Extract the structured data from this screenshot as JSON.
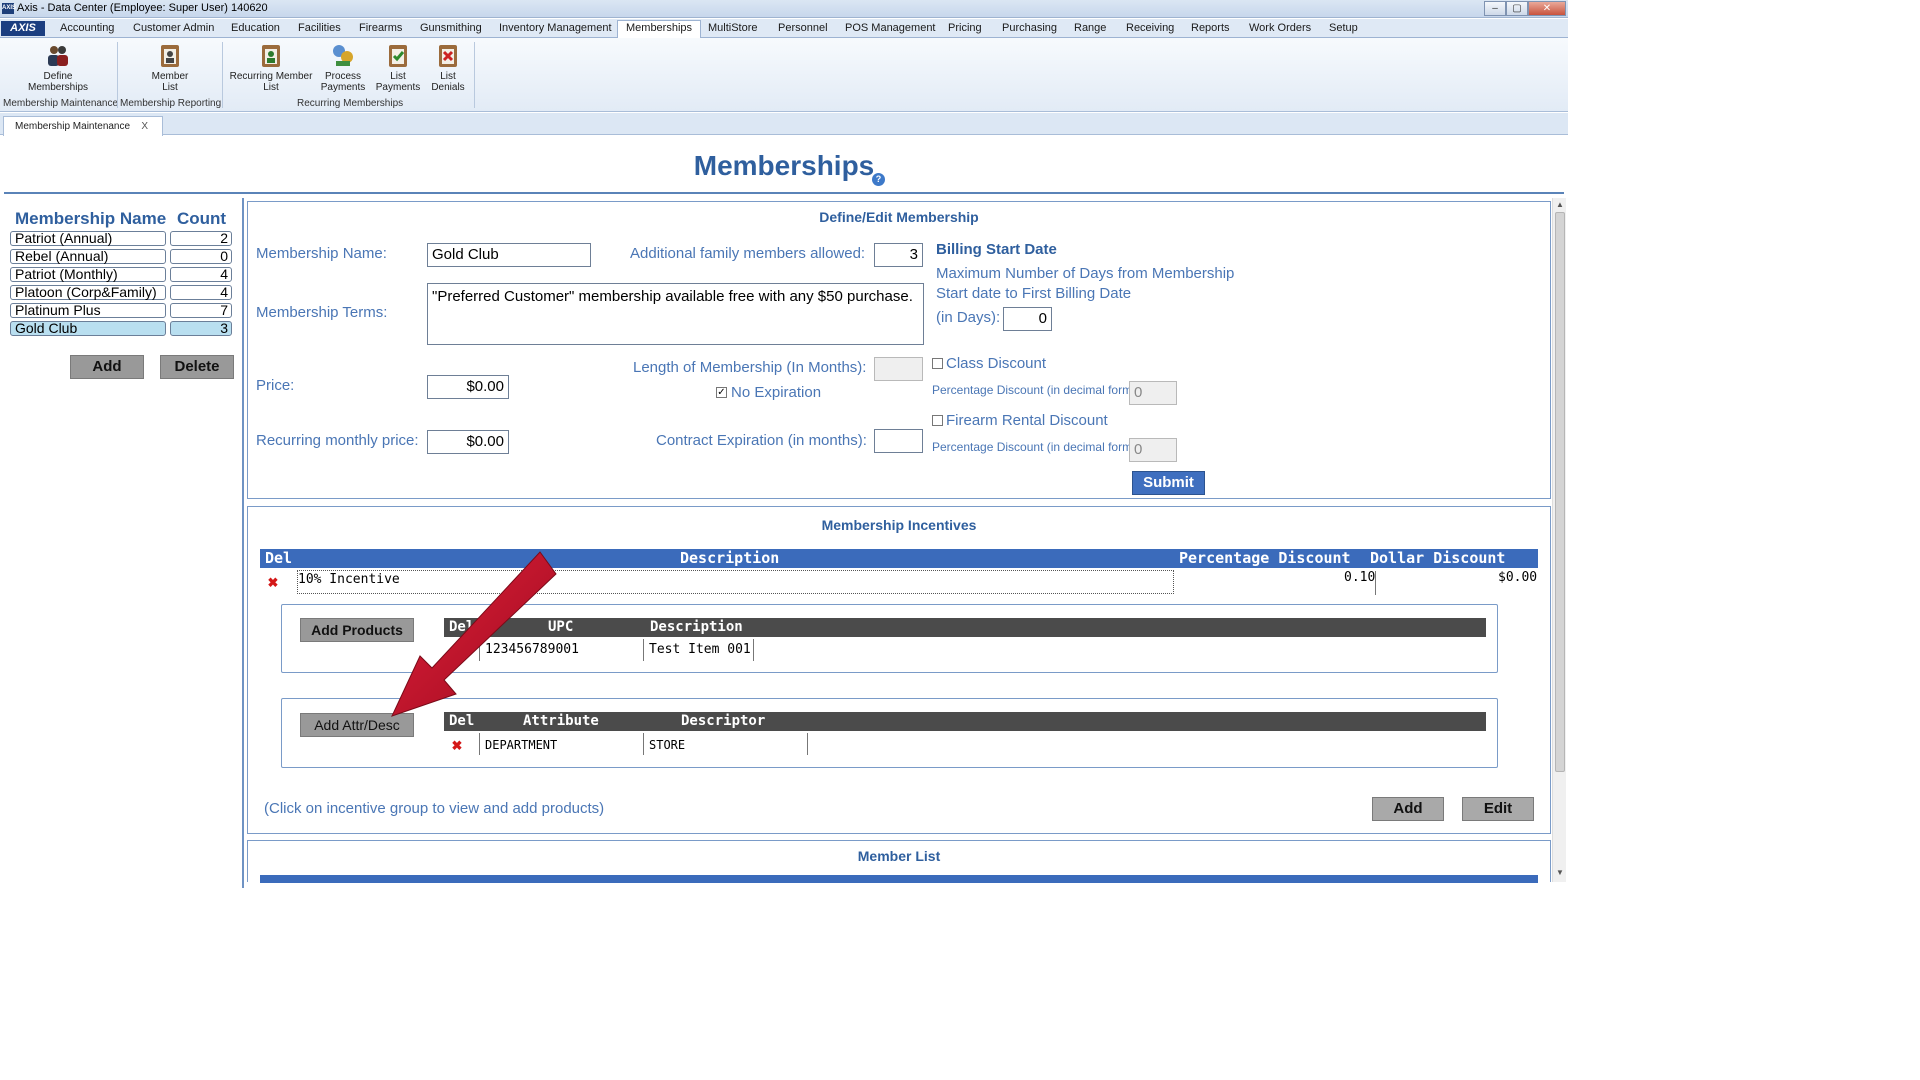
{
  "window": {
    "app_icon": "AXIS",
    "title": "Axis - Data Center  (Employee: Super User) 140620",
    "min": "–",
    "max": "▢",
    "close": "✕"
  },
  "menu": {
    "logo": "AXIS",
    "tabs": [
      "Accounting",
      "Customer Admin",
      "Education",
      "Facilities",
      "Firearms",
      "Gunsmithing",
      "Inventory Management",
      "Memberships",
      "MultiStore",
      "Personnel",
      "POS Management",
      "Pricing",
      "Purchasing",
      "Range",
      "Receiving",
      "Reports",
      "Work Orders",
      "Setup"
    ],
    "active": "Memberships"
  },
  "ribbon": {
    "buttons": [
      {
        "label1": "Define",
        "label2": "Memberships",
        "icon": "people-icon"
      },
      {
        "label1": "Member",
        "label2": "List",
        "icon": "clipboard-icon"
      },
      {
        "label1": "Recurring Member",
        "label2": "List",
        "icon": "recurring-list-icon"
      },
      {
        "label1": "Process",
        "label2": "Payments",
        "icon": "process-payments-icon"
      },
      {
        "label1": "List",
        "label2": "Payments",
        "icon": "list-payments-icon"
      },
      {
        "label1": "List",
        "label2": "Denials",
        "icon": "list-denials-icon"
      }
    ],
    "groups": [
      "Membership Maintenance",
      "Membership Reporting",
      "Recurring Memberships"
    ]
  },
  "doc_tab": {
    "label": "Membership Maintenance",
    "close": "X"
  },
  "page": {
    "title": "Memberships",
    "help": "?"
  },
  "memberships": {
    "header_name": "Membership Name",
    "header_count": "Count",
    "rows": [
      {
        "name": "Patriot (Annual)",
        "count": "2"
      },
      {
        "name": "Rebel (Annual)",
        "count": "0"
      },
      {
        "name": "Patriot (Monthly)",
        "count": "4"
      },
      {
        "name": "Platoon (Corp&Family)",
        "count": "4"
      },
      {
        "name": "Platinum Plus",
        "count": "7"
      },
      {
        "name": "Gold Club",
        "count": "3"
      }
    ],
    "selected_index": 5,
    "add_label": "Add",
    "delete_label": "Delete"
  },
  "define_edit": {
    "title": "Define/Edit Membership",
    "name_label": "Membership Name:",
    "name_value": "Gold Club",
    "family_label": "Additional family members allowed:",
    "family_value": "3",
    "terms_label": "Membership Terms:",
    "terms_value": "\"Preferred Customer\" membership available free with any $50 purchase.",
    "price_label": "Price:",
    "price_value": "$0.00",
    "length_label": "Length of Membership (In Months):",
    "length_value": "",
    "no_expiration_label": "No Expiration",
    "no_expiration_checked": true,
    "recurring_label": "Recurring monthly price:",
    "recurring_value": "$0.00",
    "contract_label": "Contract Expiration (in months):",
    "contract_value": "",
    "billing_title": "Billing Start Date",
    "billing_line1": "Maximum Number of Days from Membership",
    "billing_line2": "Start date to First Billing Date",
    "billing_days_label": "(in Days):",
    "billing_days_value": "0",
    "class_discount_label": "Class Discount",
    "class_pct_label": "Percentage Discount (in decimal form)",
    "class_pct_value": "0",
    "firearm_discount_label": "Firearm Rental Discount",
    "firearm_pct_label": "Percentage Discount (in decimal form)",
    "firearm_pct_value": "0",
    "submit_label": "Submit"
  },
  "incentives": {
    "title": "Membership Incentives",
    "headers": {
      "del": "Del",
      "description": "Description",
      "pct": "Percentage Discount",
      "dollar": "Dollar Discount"
    },
    "rows": [
      {
        "description": "10% Incentive",
        "pct": "0.10",
        "dollar": "$0.00"
      }
    ],
    "products": {
      "button": "Add Products",
      "headers": {
        "del": "Del",
        "upc": "UPC",
        "description": "Description"
      },
      "rows": [
        {
          "upc": "123456789001",
          "description": "Test Item 001"
        }
      ]
    },
    "attributes": {
      "button": "Add Attr/Desc",
      "headers": {
        "del": "Del",
        "attribute": "Attribute",
        "descriptor": "Descriptor"
      },
      "rows": [
        {
          "attribute": "DEPARTMENT",
          "descriptor": "STORE"
        }
      ]
    },
    "hint": "(Click on incentive group to view and add products)",
    "add_label": "Add",
    "edit_label": "Edit"
  },
  "member_list": {
    "title": "Member List"
  },
  "colors": {
    "accent": "#2f5f9e",
    "header_blue": "#3b6bbb",
    "arrow": "#c8102e"
  }
}
